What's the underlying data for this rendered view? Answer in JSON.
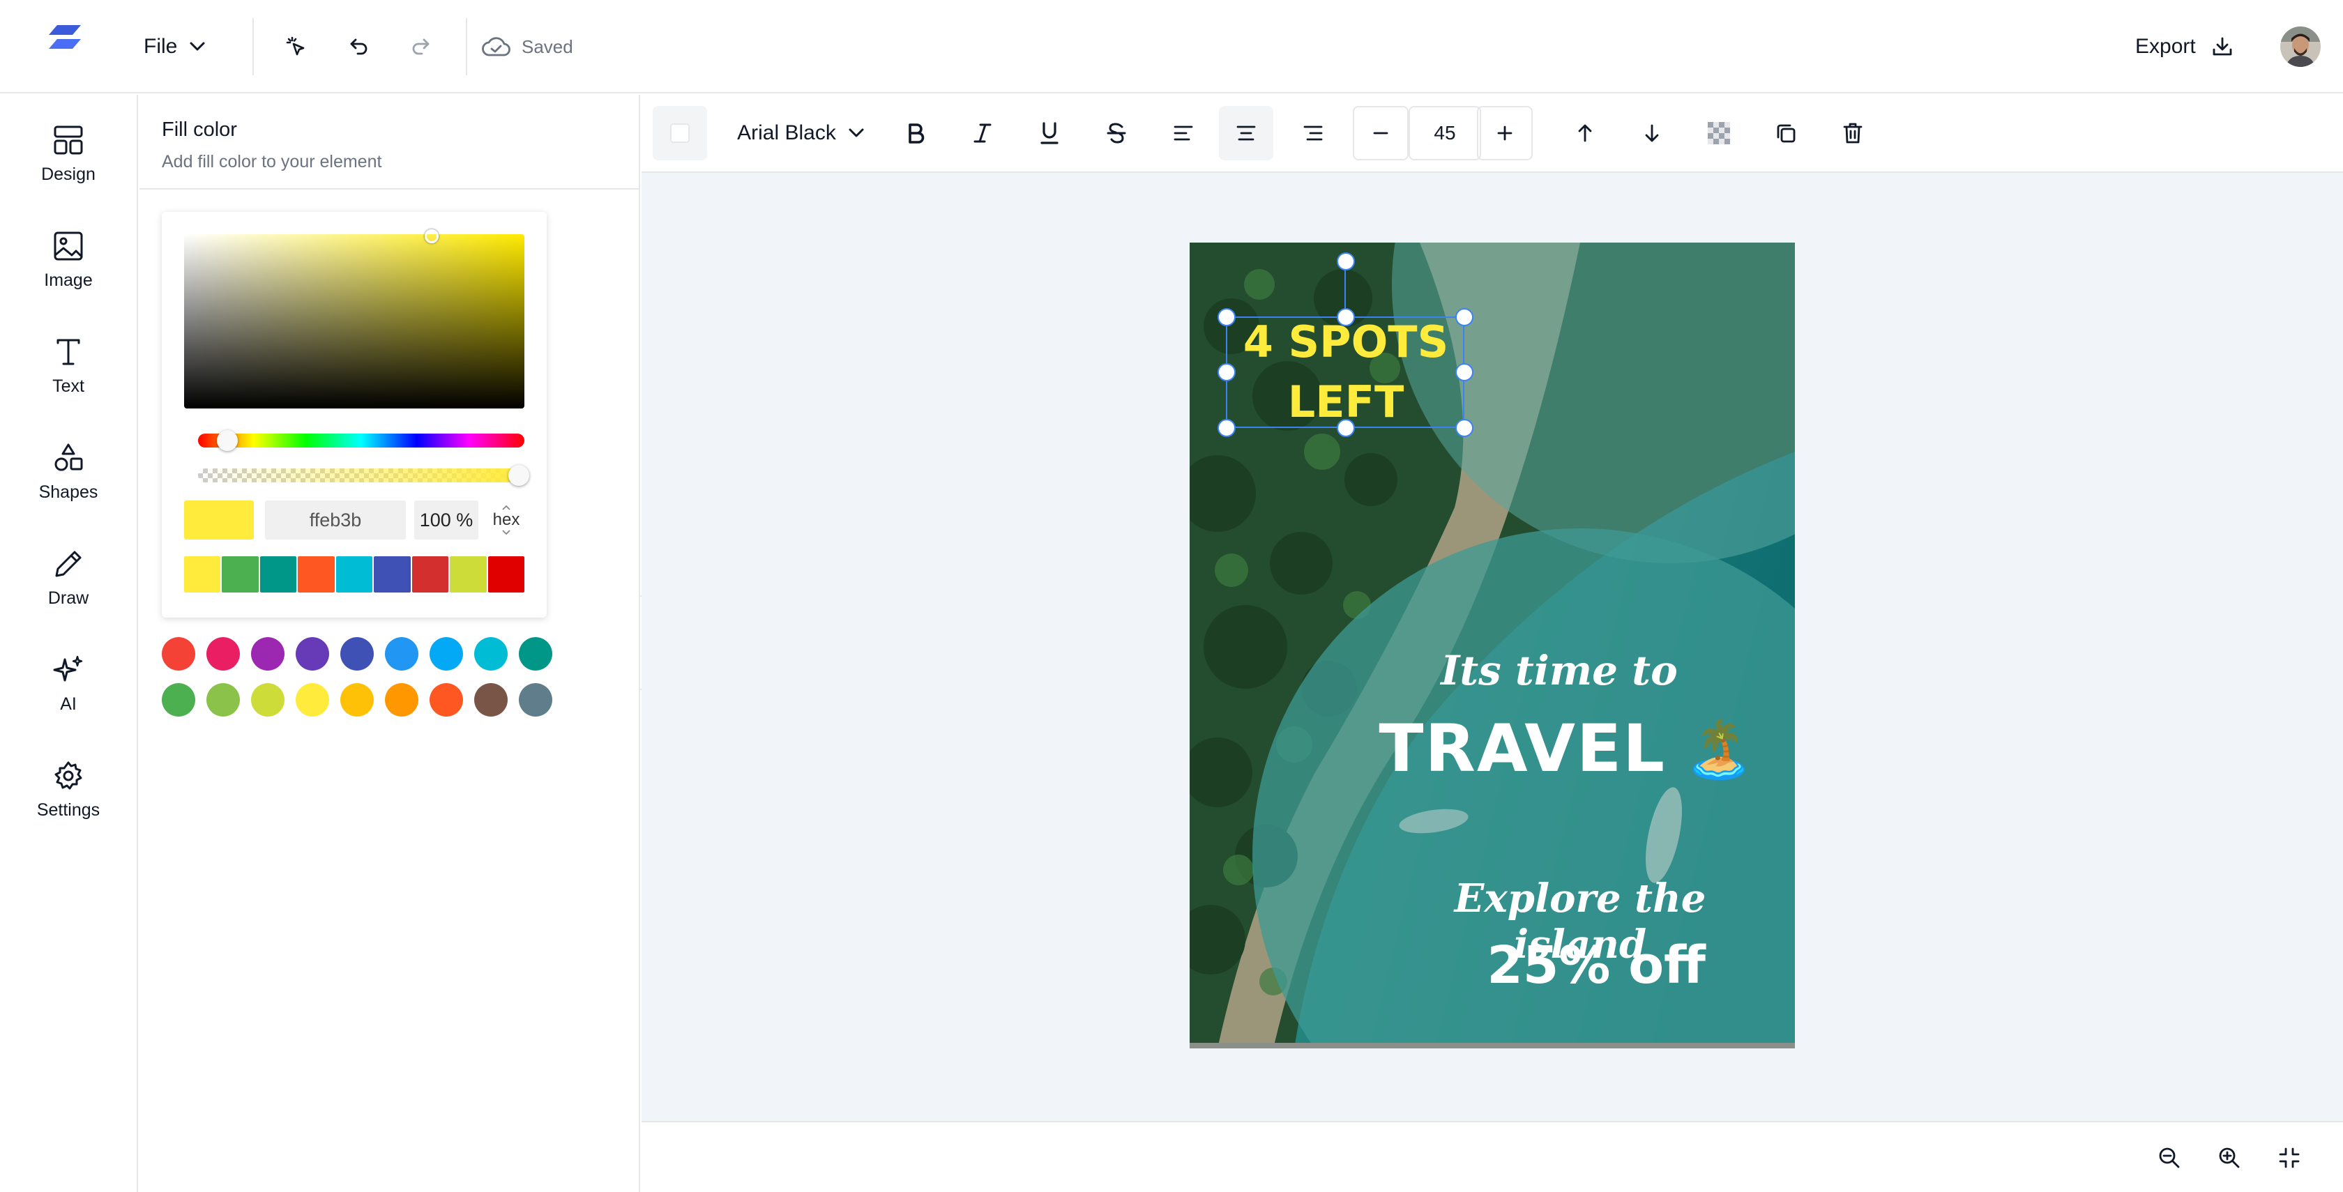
{
  "header": {
    "file_label": "File",
    "saved_label": "Saved",
    "export_label": "Export"
  },
  "sidebar": {
    "items": [
      {
        "label": "Design",
        "icon": "layout-icon"
      },
      {
        "label": "Image",
        "icon": "image-icon"
      },
      {
        "label": "Text",
        "icon": "text-icon"
      },
      {
        "label": "Shapes",
        "icon": "shapes-icon"
      },
      {
        "label": "Draw",
        "icon": "pencil-icon"
      },
      {
        "label": "AI",
        "icon": "sparkles-icon"
      },
      {
        "label": "Settings",
        "icon": "gear-icon"
      }
    ]
  },
  "fill_panel": {
    "title": "Fill color",
    "subtitle": "Add fill color to your element",
    "hex_value": "ffeb3b",
    "opacity": "100 %",
    "mode": "hex",
    "current_color": "#ffeb3b",
    "presets": [
      "#ffeb3b",
      "#4caf50",
      "#009688",
      "#ff5722",
      "#00bcd4",
      "#3f51b5",
      "#d32f2f",
      "#cddc39",
      "#e00000"
    ],
    "palette": [
      [
        "#f44336",
        "#e91e63",
        "#9c27b0",
        "#673ab7",
        "#3f51b5",
        "#2196f3",
        "#03a9f4",
        "#00bcd4",
        "#009688"
      ],
      [
        "#4caf50",
        "#8bc34a",
        "#cddc39",
        "#ffeb3b",
        "#ffc107",
        "#ff9800",
        "#ff5722",
        "#795548",
        "#607d8b"
      ]
    ]
  },
  "toolbar": {
    "font_family": "Arial Black",
    "font_size": "45"
  },
  "canvas": {
    "text_spots": "4 SPOTS LEFT",
    "text_time": "Its time to",
    "text_travel": "TRAVEL",
    "text_explore": "Explore the island",
    "text_discount": "25% off",
    "emoji": "🏝️",
    "text_color_selected": "#ffeb3b"
  }
}
